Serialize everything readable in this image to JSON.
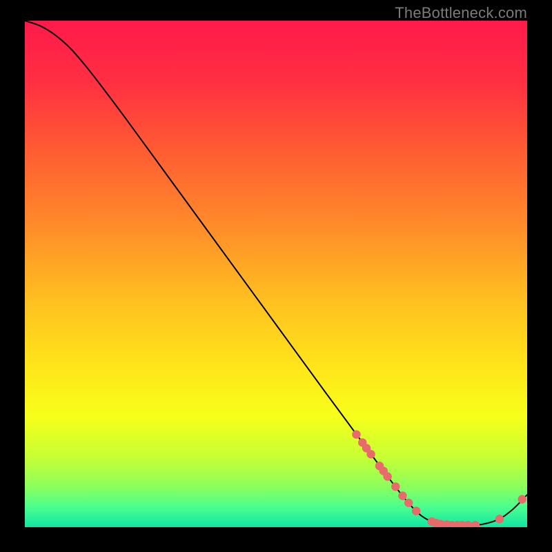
{
  "watermark": "TheBottleneck.com",
  "chart_data": {
    "type": "line",
    "title": "",
    "xlabel": "",
    "ylabel": "",
    "xlim": [
      0,
      100
    ],
    "ylim": [
      0,
      100
    ],
    "background_gradient": {
      "stops": [
        {
          "offset": 0.0,
          "color": "#ff1a4b"
        },
        {
          "offset": 0.12,
          "color": "#ff2f42"
        },
        {
          "offset": 0.25,
          "color": "#ff5a33"
        },
        {
          "offset": 0.4,
          "color": "#ff8a2a"
        },
        {
          "offset": 0.55,
          "color": "#ffbf20"
        },
        {
          "offset": 0.68,
          "color": "#ffe41a"
        },
        {
          "offset": 0.78,
          "color": "#f7ff1a"
        },
        {
          "offset": 0.86,
          "color": "#c8ff33"
        },
        {
          "offset": 0.92,
          "color": "#8bff5c"
        },
        {
          "offset": 0.96,
          "color": "#4bff8e"
        },
        {
          "offset": 1.0,
          "color": "#12e6a2"
        }
      ]
    },
    "series": [
      {
        "name": "bottleneck-curve",
        "stroke": "#000000",
        "stroke_width": 2,
        "points": [
          {
            "x": 0.0,
            "y": 100.0
          },
          {
            "x": 3.0,
            "y": 99.0
          },
          {
            "x": 6.0,
            "y": 97.2
          },
          {
            "x": 9.0,
            "y": 94.6
          },
          {
            "x": 12.0,
            "y": 91.2
          },
          {
            "x": 15.0,
            "y": 87.4
          },
          {
            "x": 20.0,
            "y": 80.8
          },
          {
            "x": 30.0,
            "y": 67.2
          },
          {
            "x": 40.0,
            "y": 53.6
          },
          {
            "x": 50.0,
            "y": 40.0
          },
          {
            "x": 60.0,
            "y": 26.4
          },
          {
            "x": 67.0,
            "y": 17.0
          },
          {
            "x": 72.0,
            "y": 10.3
          },
          {
            "x": 76.0,
            "y": 5.2
          },
          {
            "x": 79.0,
            "y": 2.2
          },
          {
            "x": 82.0,
            "y": 0.8
          },
          {
            "x": 86.0,
            "y": 0.4
          },
          {
            "x": 90.0,
            "y": 0.4
          },
          {
            "x": 94.0,
            "y": 1.4
          },
          {
            "x": 97.0,
            "y": 3.4
          },
          {
            "x": 100.0,
            "y": 6.4
          }
        ]
      }
    ],
    "markers": {
      "color": "#e86a6a",
      "radius": 6.2,
      "points": [
        {
          "x": 66.0,
          "y": 18.3
        },
        {
          "x": 67.2,
          "y": 16.7
        },
        {
          "x": 68.0,
          "y": 15.6
        },
        {
          "x": 68.9,
          "y": 14.4
        },
        {
          "x": 70.6,
          "y": 12.1
        },
        {
          "x": 71.4,
          "y": 11.1
        },
        {
          "x": 72.2,
          "y": 10.0
        },
        {
          "x": 73.8,
          "y": 8.0
        },
        {
          "x": 75.2,
          "y": 6.2
        },
        {
          "x": 76.4,
          "y": 4.8
        },
        {
          "x": 77.9,
          "y": 3.2
        },
        {
          "x": 81.0,
          "y": 1.1
        },
        {
          "x": 81.9,
          "y": 0.8
        },
        {
          "x": 82.8,
          "y": 0.6
        },
        {
          "x": 84.0,
          "y": 0.5
        },
        {
          "x": 85.0,
          "y": 0.4
        },
        {
          "x": 86.1,
          "y": 0.4
        },
        {
          "x": 87.0,
          "y": 0.4
        },
        {
          "x": 88.2,
          "y": 0.4
        },
        {
          "x": 89.7,
          "y": 0.4
        },
        {
          "x": 94.5,
          "y": 1.6
        },
        {
          "x": 99.0,
          "y": 5.5
        }
      ]
    }
  }
}
